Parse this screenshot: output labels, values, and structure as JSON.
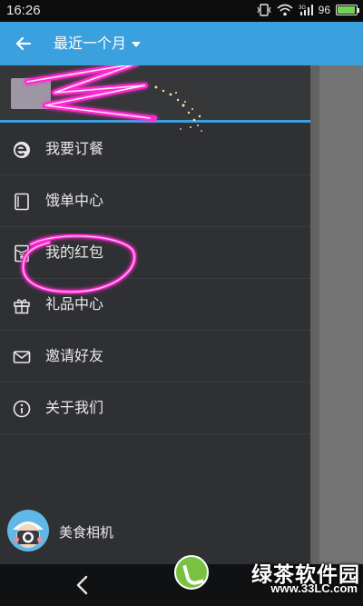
{
  "status_bar": {
    "time": "16:26",
    "signal_label": "3G",
    "battery_level": "96",
    "battery_fill_pct": 96
  },
  "toolbar": {
    "title": "最近一个月"
  },
  "menu": {
    "items": [
      {
        "label": "我要订餐",
        "icon": "e-logo-icon"
      },
      {
        "label": "饿单中心",
        "icon": "order-list-icon"
      },
      {
        "label": "我的红包",
        "icon": "red-packet-icon"
      },
      {
        "label": "礼品中心",
        "icon": "gift-icon"
      },
      {
        "label": "邀请好友",
        "icon": "mail-icon"
      },
      {
        "label": "关于我们",
        "icon": "info-icon"
      }
    ]
  },
  "bottom_app": {
    "label": "美食相机"
  },
  "watermark": {
    "main": "绿茶软件园",
    "sub": "www.33LC.com"
  },
  "colors": {
    "accent": "#3aa0de",
    "drawer_bg": "#2f3034",
    "scribble": "#ff2bd0"
  }
}
